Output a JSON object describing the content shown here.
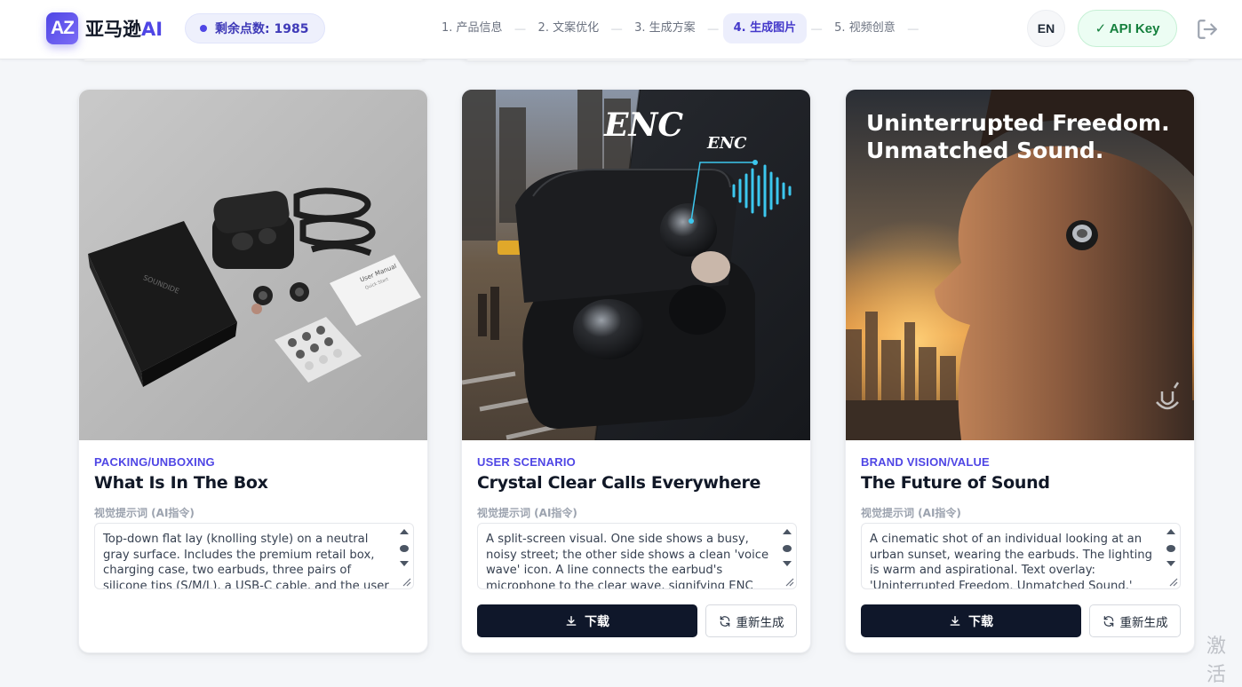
{
  "app": {
    "logo_mark": "AZ",
    "name_main": "亚马逊",
    "name_accent": "AI",
    "points_label": "剩余点数: 1985"
  },
  "steps": [
    {
      "label": "1. 产品信息",
      "active": false
    },
    {
      "label": "2. 文案优化",
      "active": false
    },
    {
      "label": "3. 生成方案",
      "active": false
    },
    {
      "label": "4. 生成图片",
      "active": true
    },
    {
      "label": "5. 视频创意",
      "active": false
    }
  ],
  "header": {
    "lang": "EN",
    "api_key": "✓ API Key"
  },
  "cards": [
    {
      "category": "PACKING/UNBOXING",
      "title": "What Is In The Box",
      "prompt_label": "视觉提示词 (AI指令)",
      "prompt": "Top-down flat lay (knolling style) on a neutral gray surface. Includes the premium retail box, charging case, two earbuds, three pairs of silicone tips (S/M/L), a USB-C cable, and the user manual.",
      "image_text": {
        "box_brand": "SOUNDIDE",
        "manual_title": "User Manual",
        "manual_sub": "Quick Start"
      }
    },
    {
      "category": "USER SCENARIO",
      "title": "Crystal Clear Calls Everywhere",
      "prompt_label": "视觉提示词 (AI指令)",
      "prompt": "A split-screen visual. One side shows a busy, noisy street; the other side shows a clean 'voice wave' icon. A line connects the earbud's microphone to the clear wave, signifying ENC (Environmental Noise Cancellation).",
      "image_text": {
        "big": "ENC",
        "small": "ENC"
      },
      "download": "下载",
      "regenerate": "重新生成"
    },
    {
      "category": "BRAND VISION/VALUE",
      "title": "The Future of Sound",
      "prompt_label": "视觉提示词 (AI指令)",
      "prompt": "A cinematic shot of an individual looking at an urban sunset, wearing the earbuds. The lighting is warm and aspirational. Text overlay: 'Uninterrupted Freedom. Unmatched Sound.' Minimalist branding.",
      "image_text": {
        "line1": "Uninterrupted Freedom.",
        "line2": "Unmatched Sound."
      },
      "download": "下载",
      "regenerate": "重新生成"
    }
  ],
  "watermark": "激活"
}
